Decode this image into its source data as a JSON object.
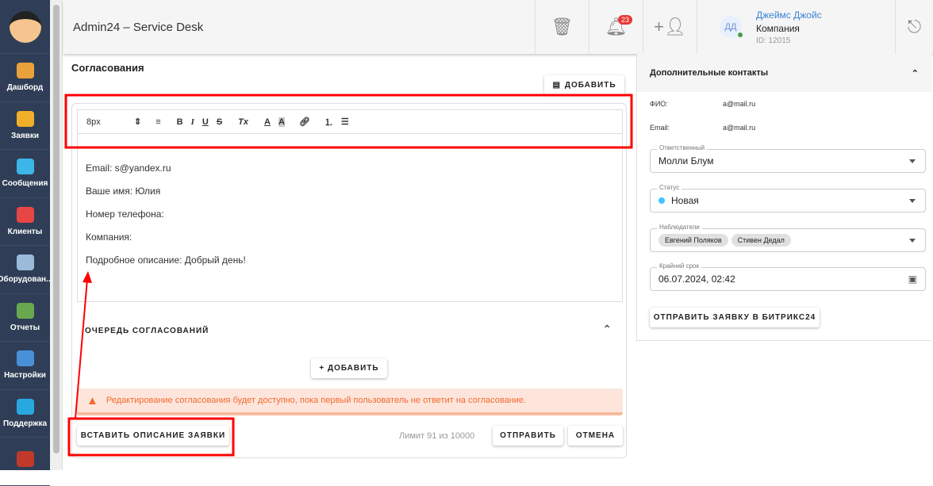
{
  "app": {
    "title": "Admin24 – Service Desk"
  },
  "sidebar": {
    "items": [
      {
        "label": "Дашборд",
        "color": "#e9a23b"
      },
      {
        "label": "Заявки",
        "color": "#f2b02a"
      },
      {
        "label": "Сообщения",
        "color": "#3cb5e8"
      },
      {
        "label": "Клиенты",
        "color": "#e84545"
      },
      {
        "label": "Оборудован...",
        "color": "#9bb9d9"
      },
      {
        "label": "Отчеты",
        "color": "#6aa84f"
      },
      {
        "label": "Настройки",
        "color": "#4a90d9"
      },
      {
        "label": "Поддержка",
        "color": "#29a8e0"
      },
      {
        "label": "",
        "color": "#c0392b"
      }
    ]
  },
  "header": {
    "notifications_count": "23",
    "user": {
      "initials": "ДД",
      "name": "Джеймс Джойс",
      "company": "Компания",
      "id": "ID: 12015"
    }
  },
  "main": {
    "section_title": "Согласования",
    "add_label": "ДОБАВИТЬ",
    "toolbar": {
      "font_size": "8px",
      "bold": "B",
      "italic": "I",
      "underline": "U",
      "strike": "S",
      "clear": "Tx",
      "color": "A",
      "bg": "A"
    },
    "editor_lines": [
      "Email: s@yandex.ru",
      "Ваше имя: Юлия",
      "Номер телефона:",
      "Компания:",
      "Подробное описание: Добрый день!"
    ],
    "queue_title": "ОЧЕРЕДЬ СОГЛАСОВАНИЙ",
    "queue_add": "+ ДОБАВИТЬ",
    "warning": "Редактирование согласования будет доступно, пока первый пользователь не ответит на согласование.",
    "insert_label": "ВСТАВИТЬ ОПИСАНИЕ ЗАЯВКИ",
    "limit": "Лимит 91 из 10000",
    "send_label": "ОТПРАВИТЬ",
    "cancel_label": "ОТМЕНА"
  },
  "right": {
    "title": "Дополнительные контакты",
    "contacts": [
      {
        "k": "ФИО:",
        "v": "a@mail.ru"
      },
      {
        "k": "Email:",
        "v": "a@mail.ru"
      }
    ],
    "responsible": {
      "label": "Ответственный",
      "value": "Молли Блум"
    },
    "status": {
      "label": "Статус",
      "value": "Новая",
      "color": "#40c4ff"
    },
    "watchers": {
      "label": "Наблюдатели",
      "chips": [
        "Евгений Поляков",
        "Стивен Дедал"
      ]
    },
    "deadline": {
      "label": "Крайний срок",
      "value": "06.07.2024, 02:42"
    },
    "bitrix_label": "ОТПРАВИТЬ ЗАЯВКУ В БИТРИКС24"
  }
}
